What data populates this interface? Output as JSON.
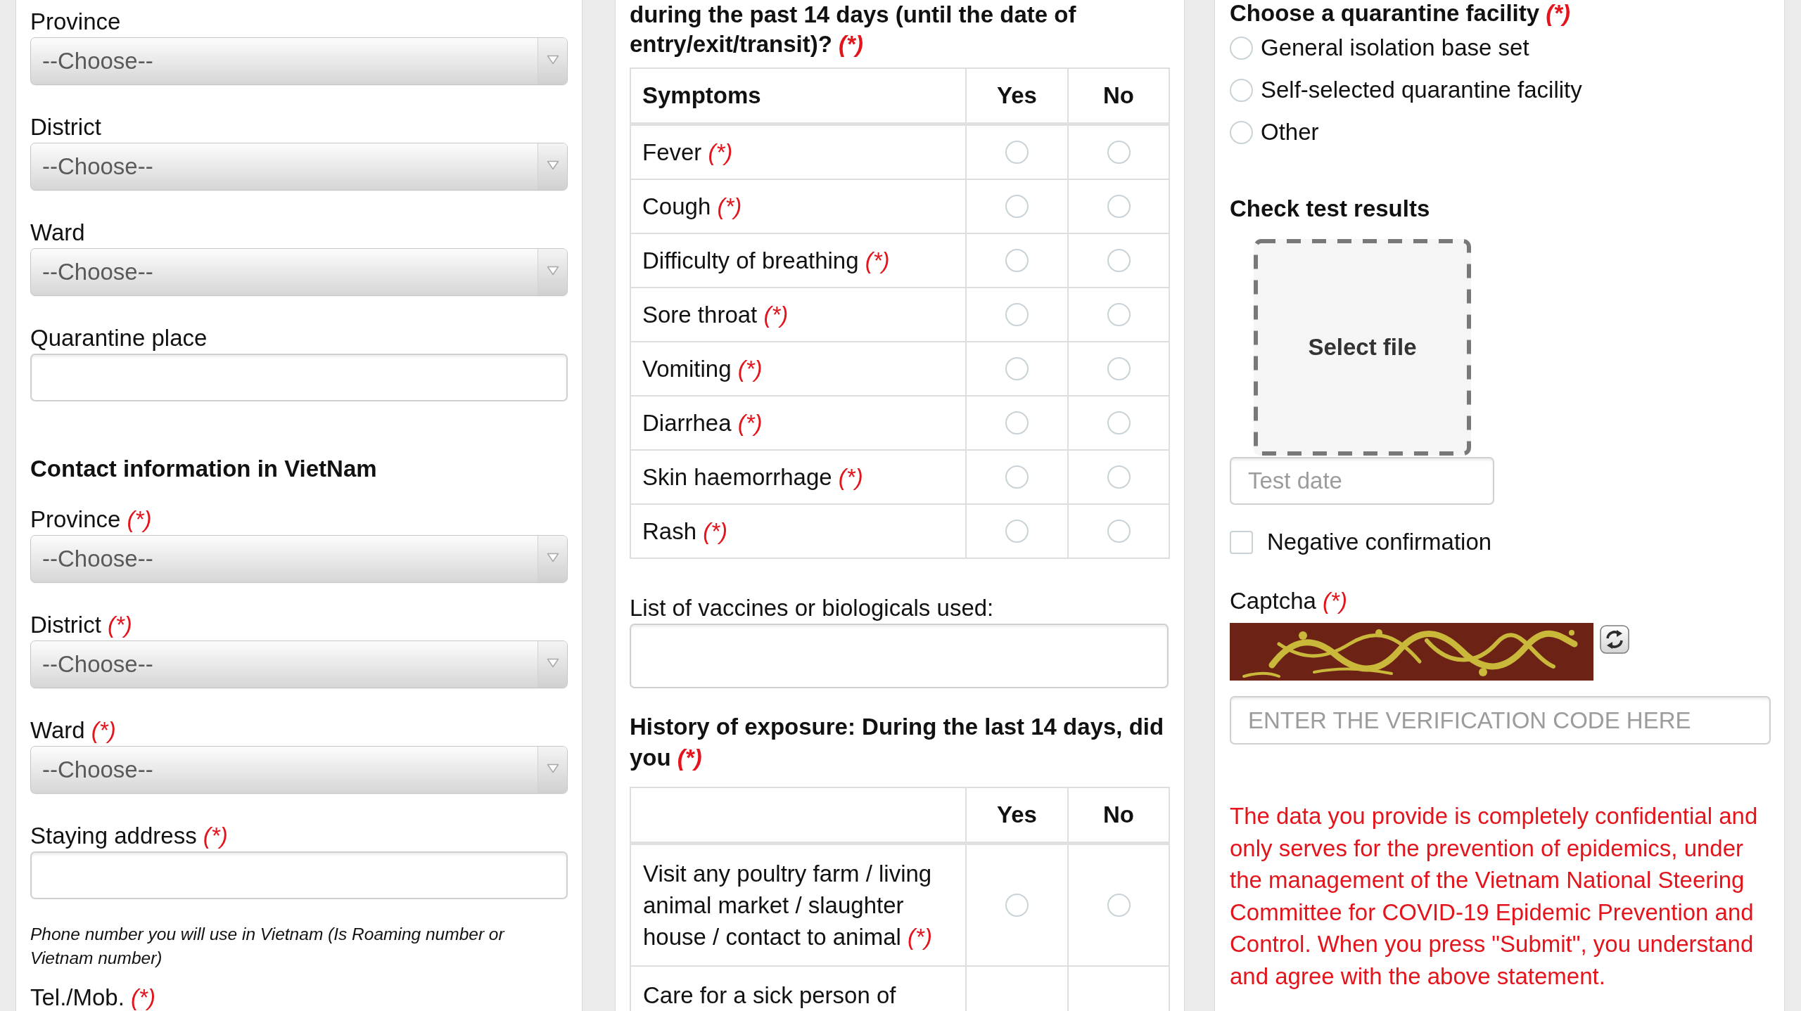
{
  "left_panel": {
    "items": [
      {
        "kind": "select",
        "label": "Province",
        "value": "--Choose--"
      },
      {
        "kind": "select",
        "label": "District",
        "value": "--Choose--"
      },
      {
        "kind": "select",
        "label": "Ward",
        "value": "--Choose--"
      },
      {
        "kind": "text",
        "label": "Quarantine place"
      },
      {
        "kind": "heading",
        "text": "Contact information in VietNam"
      },
      {
        "kind": "select",
        "label": "Province",
        "required_mark": "(*)",
        "value": "--Choose--"
      },
      {
        "kind": "select",
        "label": "District",
        "required_mark": "(*)",
        "value": "--Choose--"
      },
      {
        "kind": "select",
        "label": "Ward",
        "required_mark": "(*)",
        "value": "--Choose--"
      },
      {
        "kind": "text",
        "label": "Staying address",
        "required_mark": "(*)"
      },
      {
        "kind": "note",
        "text": "Phone number you will use in Vietnam (Is Roaming number or Vietnam number)"
      },
      {
        "kind": "label",
        "label": "Tel./Mob.",
        "required_mark": "(*)"
      }
    ]
  },
  "middle_panel": {
    "question": {
      "text": "during the past 14 days (until the date of entry/exit/transit)?",
      "required_mark": "(*)"
    },
    "symptoms_table": {
      "label_column": "Symptoms",
      "option_columns": [
        "Yes",
        "No"
      ],
      "rows": [
        {
          "label": "Fever",
          "required_mark": "(*)",
          "options": [
            {
              "selected": false
            },
            {
              "selected": false
            }
          ]
        },
        {
          "label": "Cough",
          "required_mark": "(*)",
          "options": [
            {
              "selected": false
            },
            {
              "selected": false
            }
          ]
        },
        {
          "label": "Difficulty of breathing",
          "required_mark": "(*)",
          "options": [
            {
              "selected": false
            },
            {
              "selected": false
            }
          ]
        },
        {
          "label": "Sore throat",
          "required_mark": "(*)",
          "options": [
            {
              "selected": false
            },
            {
              "selected": false
            }
          ]
        },
        {
          "label": "Vomiting",
          "required_mark": "(*)",
          "options": [
            {
              "selected": false
            },
            {
              "selected": false
            }
          ]
        },
        {
          "label": "Diarrhea",
          "required_mark": "(*)",
          "options": [
            {
              "selected": false
            },
            {
              "selected": false
            }
          ]
        },
        {
          "label": "Skin haemorrhage",
          "required_mark": "(*)",
          "options": [
            {
              "selected": false
            },
            {
              "selected": false
            }
          ]
        },
        {
          "label": "Rash",
          "required_mark": "(*)",
          "options": [
            {
              "selected": false
            },
            {
              "selected": false
            }
          ]
        }
      ]
    },
    "vaccines": {
      "label": "List of vaccines or biologicals used:"
    },
    "exposure_question": {
      "text": "History of exposure: During the last 14 days, did you",
      "required_mark": "(*)"
    },
    "exposure_table": {
      "option_columns": [
        "Yes",
        "No"
      ],
      "rows": [
        {
          "label": "Visit any poultry farm / living animal market / slaughter house / contact to animal",
          "required_mark": "(*)",
          "options": [
            {
              "selected": false
            },
            {
              "selected": false
            }
          ]
        },
        {
          "label": "Care for a sick person of"
        }
      ]
    }
  },
  "right_panel": {
    "facility_question": {
      "text": "Choose a quarantine facility",
      "required_mark": "(*)"
    },
    "facility_options": [
      {
        "label": "General isolation base set",
        "selected": false
      },
      {
        "label": "Self-selected quarantine facility",
        "selected": false
      },
      {
        "label": "Other",
        "selected": false
      }
    ],
    "test_results": {
      "heading": "Check test results",
      "upload_label": "Select file",
      "date_placeholder": "Test date",
      "negative_confirmation": {
        "label": "Negative confirmation",
        "checked": false
      }
    },
    "captcha": {
      "label": "Captcha",
      "required_mark": "(*)",
      "placeholder": "ENTER THE VERIFICATION CODE HERE"
    },
    "notice": "The data you provide is completely confidential and only serves for the prevention of epidemics, under the management of the Vietnam National Steering Committee for COVID-19 Epidemic Prevention and Control. When you press \"Submit\", you understand and agree with the above statement."
  }
}
